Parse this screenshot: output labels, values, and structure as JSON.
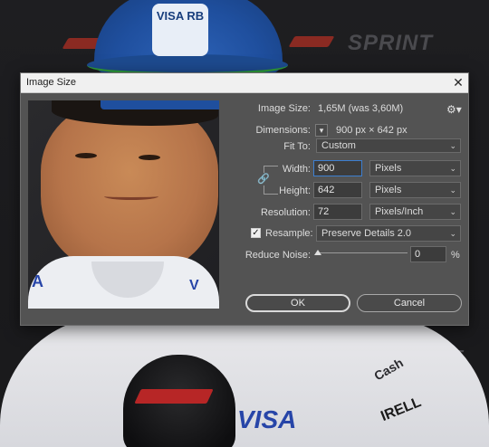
{
  "background": {
    "sprint_text": "SPRINT",
    "cap_logo": "VISA RB",
    "visa_text": "VISA",
    "cash_text": "Cash",
    "pirelli_text": "IRELL",
    "preview_logo_a": "A",
    "preview_logo_v": "V"
  },
  "dialog": {
    "title": "Image Size",
    "close_glyph": "✕",
    "image_size_label": "Image Size:",
    "image_size_value": "1,65M (was 3,60M)",
    "gear_glyph": "⚙▾",
    "dimensions_label": "Dimensions:",
    "dimensions_value": "900 px  ×  642 px",
    "fit_to_label": "Fit To:",
    "fit_to_value": "Custom",
    "width_label": "Width:",
    "width_value": "900",
    "width_unit": "Pixels",
    "height_label": "Height:",
    "height_value": "642",
    "height_unit": "Pixels",
    "resolution_label": "Resolution:",
    "resolution_value": "72",
    "resolution_unit": "Pixels/Inch",
    "resample_label": "Resample:",
    "resample_checked": true,
    "resample_value": "Preserve Details 2.0",
    "reduce_noise_label": "Reduce Noise:",
    "reduce_noise_value": "0",
    "reduce_noise_unit": "%",
    "ok_label": "OK",
    "cancel_label": "Cancel"
  },
  "colors": {
    "dialog_bg": "#535353",
    "titlebar_bg": "#f0f0f0",
    "focus_border": "#3d7fd0"
  }
}
